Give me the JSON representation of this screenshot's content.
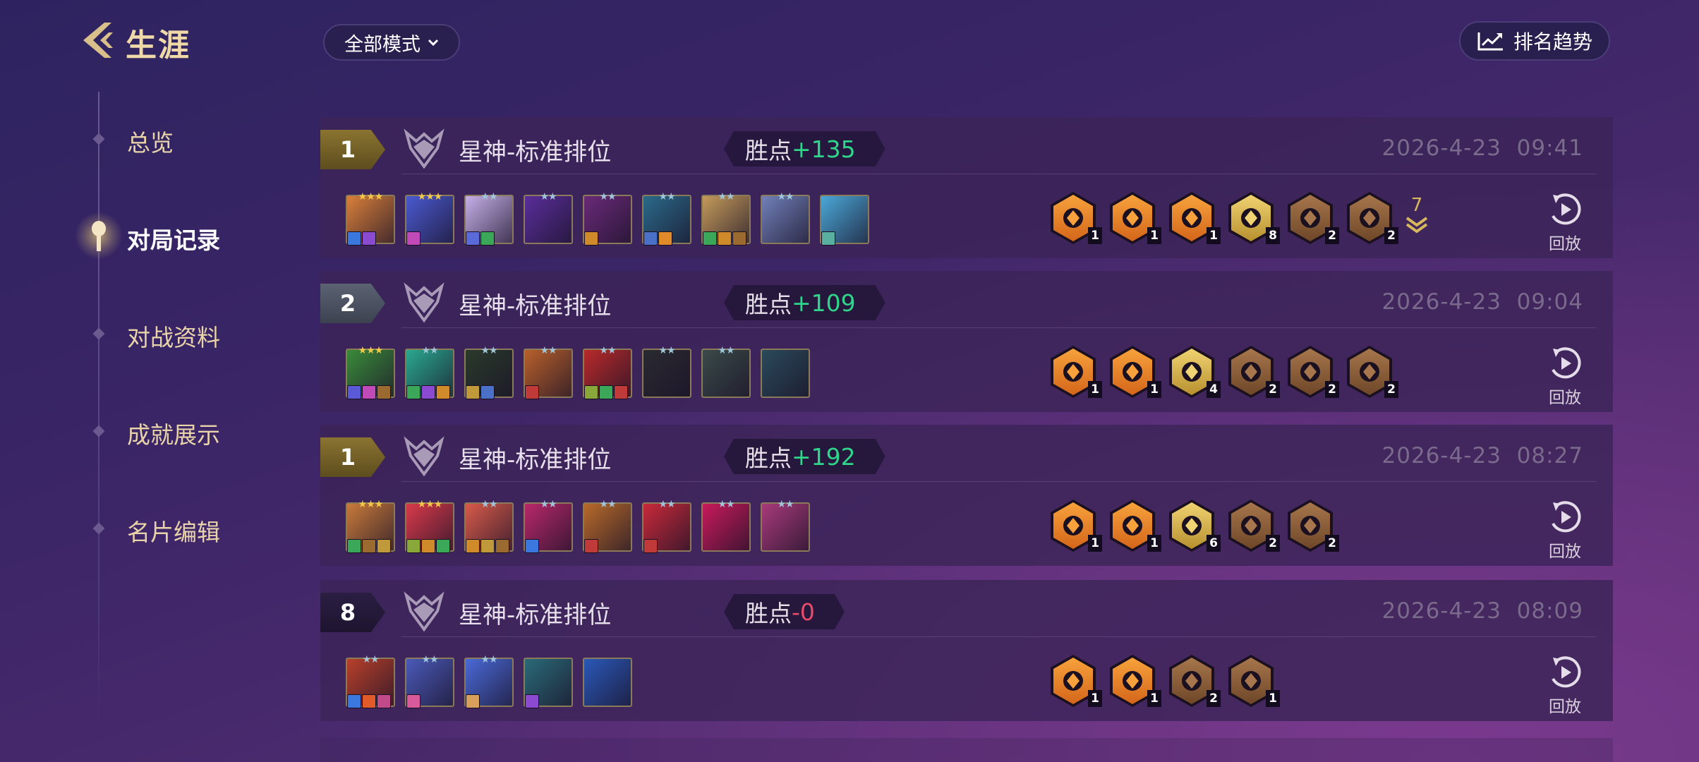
{
  "header": {
    "title": "生涯",
    "mode_select": "全部模式",
    "rank_trend": "排名趋势"
  },
  "sidebar": {
    "items": [
      {
        "label": "总览"
      },
      {
        "label": "对局记录"
      },
      {
        "label": "对战资料"
      },
      {
        "label": "成就展示"
      },
      {
        "label": "名片编辑"
      }
    ],
    "active": "对局记录"
  },
  "colors": {
    "accent_gold": "#d8b75c",
    "lp_positive": "#2fd68a",
    "lp_zero": "#e84a6a",
    "trait_gold": "#e6c45a",
    "trait_orange": "#f08c2c",
    "trait_bronze": "#9b6a45"
  },
  "replay_label": "回放",
  "matches": [
    {
      "placement": "1",
      "placement_style": "gold",
      "mode": "星神-标准排位",
      "lp_label": "胜点",
      "lp_value": "+135",
      "lp_sign": "plus",
      "date": "2026-4-23",
      "time": "09:41",
      "units": [
        {
          "stars": 3,
          "star_color": "gold",
          "color": "#d9803a",
          "items": [
            "#3a78e0",
            "#8a4bd0"
          ]
        },
        {
          "stars": 3,
          "star_color": "gold",
          "color": "#4a5ad0",
          "items": [
            "#c04ab8"
          ]
        },
        {
          "stars": 2,
          "star_color": "silver",
          "color": "#c6b0e8",
          "items": [
            "#5a6ad8",
            "#3aa858"
          ]
        },
        {
          "stars": 2,
          "star_color": "silver",
          "color": "#5a2e9a",
          "items": []
        },
        {
          "stars": 2,
          "star_color": "silver",
          "color": "#6a2a78",
          "items": [
            "#d08a2a"
          ]
        },
        {
          "stars": 2,
          "star_color": "silver",
          "color": "#2a6a8a",
          "items": [
            "#4a70c8",
            "#e08a2a"
          ]
        },
        {
          "stars": 2,
          "star_color": "silver",
          "color": "#c49a5a",
          "items": [
            "#3aa858",
            "#d08a2a",
            "#9a6a30"
          ]
        },
        {
          "stars": 2,
          "star_color": "silver",
          "color": "#7080b8",
          "items": []
        },
        {
          "stars": 0,
          "star_color": "silver",
          "color": "#4aa8d8",
          "items": [
            "#5ab0a0"
          ]
        }
      ],
      "traits": [
        {
          "count": "1",
          "tier": "orange",
          "icon": "chain-trait-icon"
        },
        {
          "count": "1",
          "tier": "orange",
          "icon": "beast-trait-icon"
        },
        {
          "count": "1",
          "tier": "orange",
          "icon": "burst-trait-icon"
        },
        {
          "count": "8",
          "tier": "gold",
          "icon": "star-trait-icon"
        },
        {
          "count": "2",
          "tier": "bronze",
          "icon": "shield-trait-icon"
        },
        {
          "count": "2",
          "tier": "bronze",
          "icon": "crest-trait-icon"
        }
      ],
      "more_traits": "7"
    },
    {
      "placement": "2",
      "placement_style": "silver",
      "mode": "星神-标准排位",
      "lp_label": "胜点",
      "lp_value": "+109",
      "lp_sign": "plus",
      "date": "2026-4-23",
      "time": "09:04",
      "units": [
        {
          "stars": 3,
          "star_color": "gold",
          "color": "#3a8a3a",
          "items": [
            "#5a5ad8",
            "#c04ab8",
            "#9a6a30"
          ]
        },
        {
          "stars": 2,
          "star_color": "silver",
          "color": "#2aa890",
          "items": [
            "#3aa858",
            "#8a4bd0",
            "#d08a2a"
          ]
        },
        {
          "stars": 2,
          "star_color": "silver",
          "color": "#2a3a2a",
          "items": [
            "#c09a3a",
            "#4a70c8"
          ]
        },
        {
          "stars": 2,
          "star_color": "silver",
          "color": "#b8602a",
          "items": [
            "#c03a3a"
          ]
        },
        {
          "stars": 2,
          "star_color": "silver",
          "color": "#b82a2a",
          "items": [
            "#8aa83a",
            "#3aa858",
            "#c03a3a"
          ]
        },
        {
          "stars": 2,
          "star_color": "silver",
          "color": "#2a2a30",
          "items": []
        },
        {
          "stars": 2,
          "star_color": "silver",
          "color": "#3a4a48",
          "items": []
        },
        {
          "stars": 0,
          "star_color": "silver",
          "color": "#2a4a5a",
          "items": []
        }
      ],
      "traits": [
        {
          "count": "1",
          "tier": "orange",
          "icon": "runner-trait-icon"
        },
        {
          "count": "1",
          "tier": "orange",
          "icon": "split-trait-icon"
        },
        {
          "count": "4",
          "tier": "gold",
          "icon": "guardian-trait-icon"
        },
        {
          "count": "2",
          "tier": "bronze",
          "icon": "fist-trait-icon"
        },
        {
          "count": "2",
          "tier": "bronze",
          "icon": "blade-trait-icon"
        },
        {
          "count": "2",
          "tier": "bronze",
          "icon": "eye-trait-icon"
        }
      ],
      "more_traits": ""
    },
    {
      "placement": "1",
      "placement_style": "gold",
      "mode": "星神-标准排位",
      "lp_label": "胜点",
      "lp_value": "+192",
      "lp_sign": "plus",
      "date": "2026-4-23",
      "time": "08:27",
      "units": [
        {
          "stars": 3,
          "star_color": "gold",
          "color": "#c87a3a",
          "items": [
            "#3aa858",
            "#9a6a30",
            "#c09a3a"
          ]
        },
        {
          "stars": 3,
          "star_color": "gold",
          "color": "#d83a4a",
          "items": [
            "#8aa83a",
            "#d08a2a",
            "#3aa858"
          ]
        },
        {
          "stars": 2,
          "star_color": "silver",
          "color": "#d85a4a",
          "items": [
            "#d08a2a",
            "#c09a3a",
            "#9a6a30"
          ]
        },
        {
          "stars": 2,
          "star_color": "silver",
          "color": "#b8286a",
          "items": [
            "#3a78e0"
          ]
        },
        {
          "stars": 2,
          "star_color": "silver",
          "color": "#b86a2a",
          "items": [
            "#c03a3a"
          ]
        },
        {
          "stars": 2,
          "star_color": "silver",
          "color": "#c82a3a",
          "items": [
            "#c03a3a"
          ]
        },
        {
          "stars": 2,
          "star_color": "silver",
          "color": "#c81a5a",
          "items": []
        },
        {
          "stars": 2,
          "star_color": "silver",
          "color": "#a83a7a",
          "items": []
        }
      ],
      "traits": [
        {
          "count": "1",
          "tier": "orange",
          "icon": "helm-trait-icon"
        },
        {
          "count": "1",
          "tier": "orange",
          "icon": "split-trait-icon"
        },
        {
          "count": "6",
          "tier": "gold",
          "icon": "swirl-trait-icon"
        },
        {
          "count": "2",
          "tier": "bronze",
          "icon": "fist-trait-icon"
        },
        {
          "count": "2",
          "tier": "bronze",
          "icon": "eye-trait-icon"
        }
      ],
      "more_traits": ""
    },
    {
      "placement": "8",
      "placement_style": "dark",
      "mode": "星神-标准排位",
      "lp_label": "胜点",
      "lp_value": "-0",
      "lp_sign": "zero",
      "date": "2026-4-23",
      "time": "08:09",
      "units": [
        {
          "stars": 2,
          "star_color": "silver",
          "color": "#b8402a",
          "items": [
            "#3a78e0",
            "#e05a2a",
            "#c04a8a"
          ]
        },
        {
          "stars": 2,
          "star_color": "silver",
          "color": "#4a5ab8",
          "items": [
            "#d85a9a"
          ]
        },
        {
          "stars": 2,
          "star_color": "silver",
          "color": "#4a6ad8",
          "items": [
            "#d8a05a"
          ]
        },
        {
          "stars": 0,
          "star_color": "silver",
          "color": "#2a6a78",
          "items": [
            "#8a4bd0"
          ]
        },
        {
          "stars": 0,
          "star_color": "silver",
          "color": "#2a58b8",
          "items": []
        }
      ],
      "traits": [
        {
          "count": "1",
          "tier": "orange",
          "icon": "chain-trait-icon"
        },
        {
          "count": "1",
          "tier": "orange",
          "icon": "angel-trait-icon"
        },
        {
          "count": "2",
          "tier": "bronze",
          "icon": "mask-trait-icon"
        },
        {
          "count": "1",
          "tier": "bronze",
          "icon": "bell-trait-icon"
        }
      ],
      "more_traits": ""
    }
  ]
}
